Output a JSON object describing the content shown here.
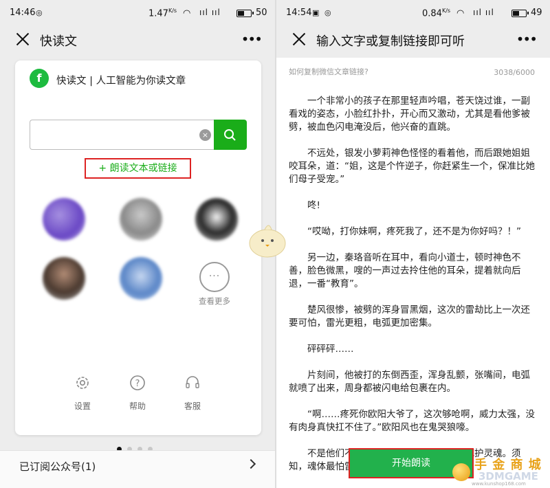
{
  "left": {
    "status": {
      "time": "14:46",
      "speed": "1.47",
      "speed_unit": "K/s",
      "battery": "50",
      "signal": "ııl ııl"
    },
    "title": "快读文",
    "more": "•••",
    "card": {
      "logo_text": "f",
      "title": "快读文 | 人工智能为你读文章",
      "search_value": "",
      "clear_icon": "×",
      "read_link": "+ 朗读文本或链接",
      "see_more_dots": "···",
      "see_more_label": "查看更多",
      "bottom": [
        {
          "label": "设置",
          "icon": "gear-icon"
        },
        {
          "label": "帮助",
          "icon": "help-icon"
        },
        {
          "label": "客服",
          "icon": "headset-icon"
        }
      ]
    },
    "pager": {
      "count": 4,
      "active": 0
    },
    "subscribed": "已订阅公众号(1)"
  },
  "right": {
    "status": {
      "time": "14:54",
      "speed": "0.84",
      "speed_unit": "K/s",
      "battery": "49",
      "signal": "ııl ııl"
    },
    "title": "输入文字或复制链接即可听",
    "more": "•••",
    "hint": "如何复制微信文章链接?",
    "counter": "3038/6000",
    "paragraphs": [
      "一个非常小的孩子在那里轻声吟唱，苍天饶过谁，一副看戏的姿态，小脸红扑扑，开心而又激动，尤其是看他爹被劈，被血色闪电淹没后，他兴奋的直跳。",
      "不远处，银发小萝莉神色怪怪的看着他，而后跟她姐姐咬耳朵，道：“姐，这是个忤逆子，你赶紧生一个，保准比她们母子受宠。”",
      "咚!",
      "“哎呦，打你妹啊，疼死我了，还不是为你好吗？！”",
      "另一边，秦珞音听在耳中，看向小道士，顿时神色不善，脸色微黑，嗖的一声过去拎住他的耳朵，提着就向后退，一番“教育”。",
      "楚风很惨，被劈的浑身冒黑烟，这次的雷劫比上一次还要可怕，雷光更粗，电弧更加密集。",
      "砰砰砰……",
      "片刻间，他被打的东倒西歪，浑身乱颤，张嘴间，电弧就喷了出来，周身都被闪电给包裹在内。",
      "“啊……疼死你欧阳大爷了，这次够呛啊，威力太强，没有肉身真快扛不住了。”欧阳风也在鬼哭狼嚎。",
      "不是他们不够强，主要是因为没有肉身庇护灵魂。须知，魂体最怕雷击!"
    ],
    "start_button": "开始朗读"
  },
  "watermark": {
    "cn": "手 金 商 城",
    "en": "3DMGAME",
    "url": "www.kunshop168.com"
  },
  "colors": {
    "accent_green": "#1aad19",
    "highlight_red": "#dd2222"
  }
}
